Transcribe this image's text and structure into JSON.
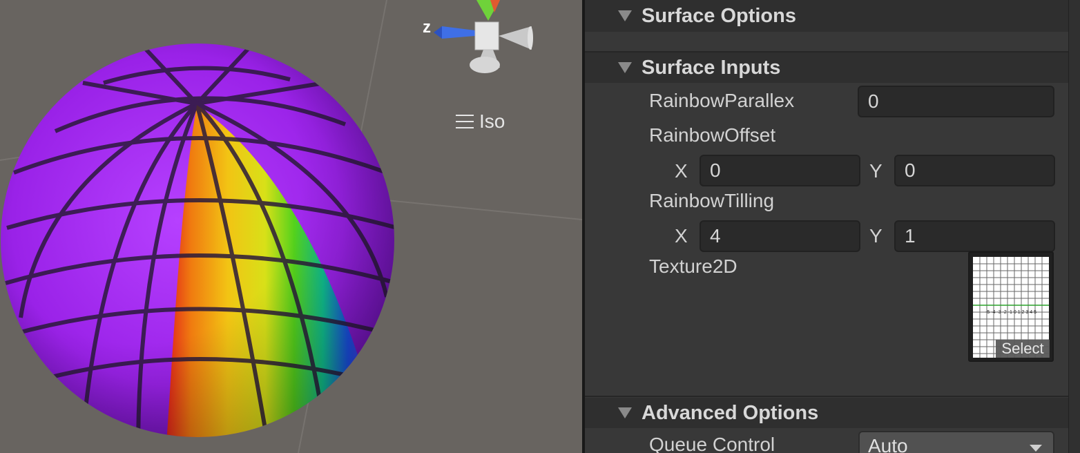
{
  "scene": {
    "gizmo_axis_label": "z",
    "projection_label": "Iso",
    "menu_icon": "hamburger-icon"
  },
  "inspector": {
    "sections": {
      "surface_options": "Surface Options",
      "surface_inputs": "Surface Inputs",
      "advanced_options": "Advanced Options"
    },
    "rainbow_parallex": {
      "label": "RainbowParallex",
      "value": "0"
    },
    "rainbow_offset": {
      "label": "RainbowOffset",
      "x_label": "X",
      "x_value": "0",
      "y_label": "Y",
      "y_value": "0"
    },
    "rainbow_tilling": {
      "label": "RainbowTilling",
      "x_label": "X",
      "x_value": "4",
      "y_label": "Y",
      "y_value": "1"
    },
    "texture2d": {
      "label": "Texture2D",
      "select_label": "Select",
      "preview_digits": "-5 -4 -3 -2 -1 0 1 2 3 4 5"
    },
    "queue_control": {
      "label": "Queue Control",
      "value": "Auto"
    }
  },
  "colors": {
    "scene_bg": "#686460",
    "inspector_bg": "#383838",
    "sphere_purple": "#a020f0",
    "gizmo_y": "#6fd23a",
    "gizmo_z": "#3f6fe6"
  }
}
